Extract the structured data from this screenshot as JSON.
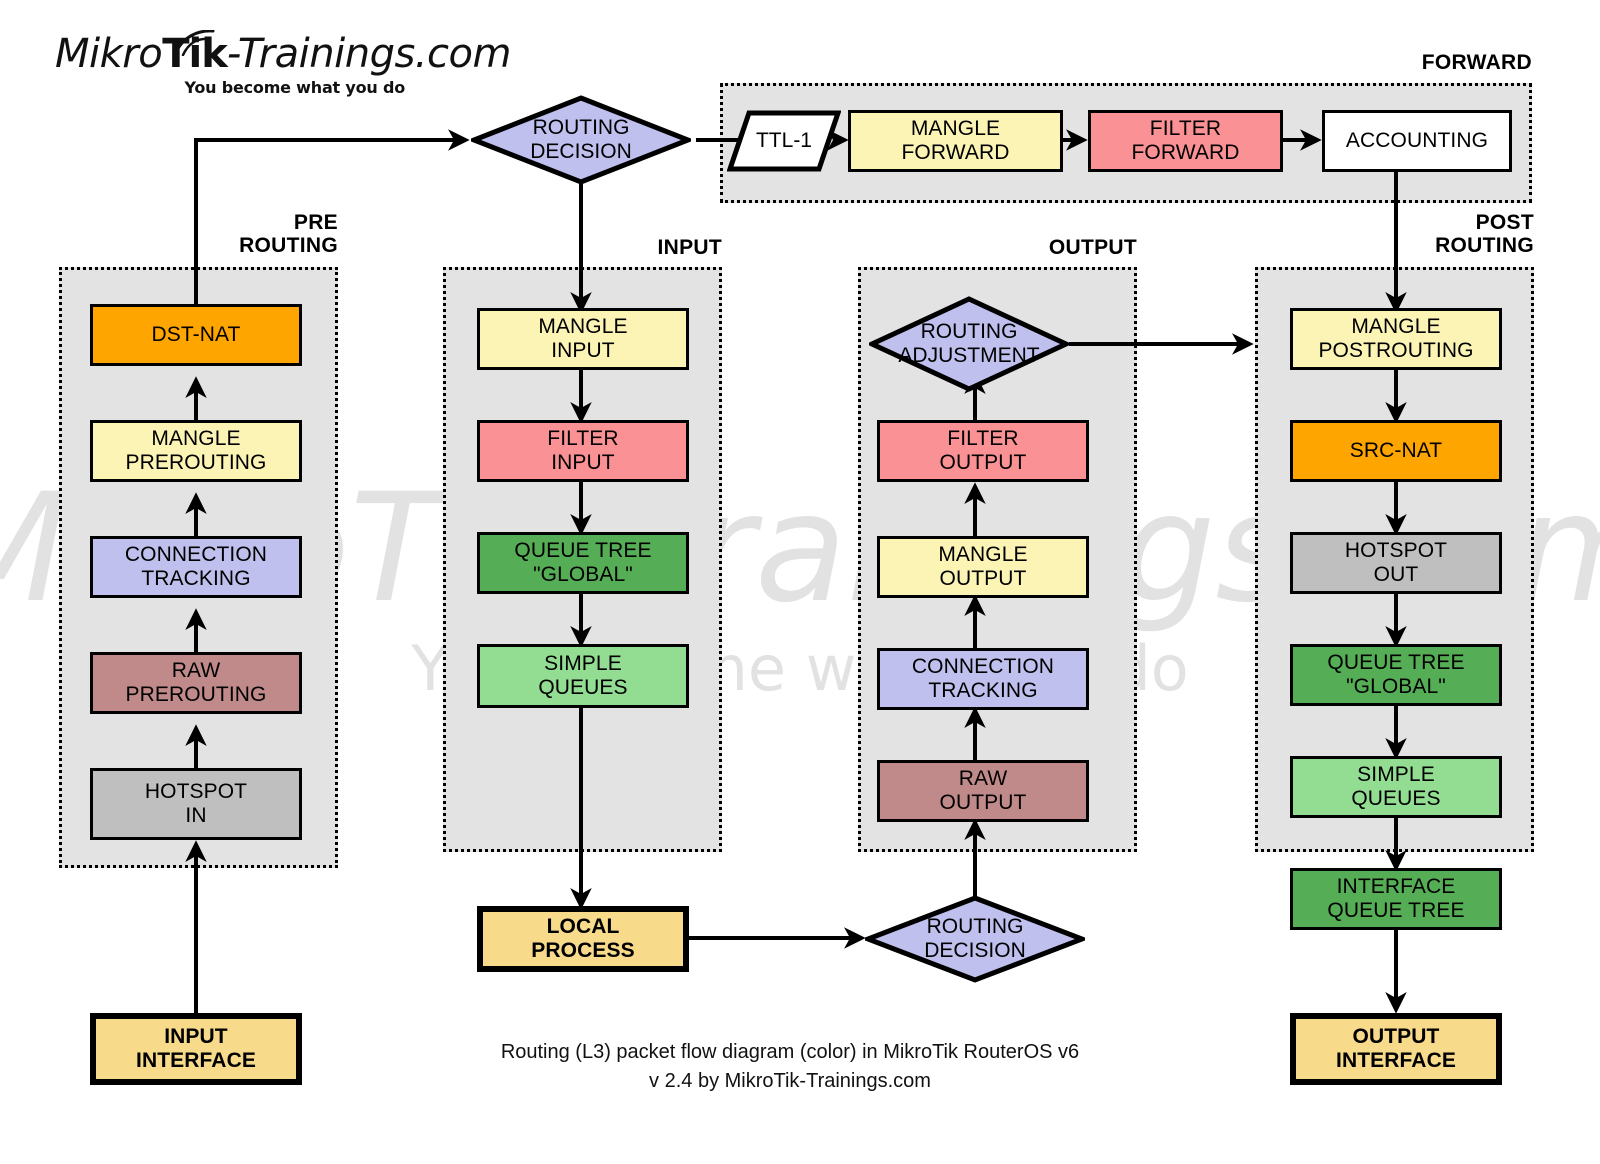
{
  "logo": {
    "part1": "Mikro",
    "part2": "Tik",
    "part3": "-Trainings.com",
    "tagline": "You become what you do"
  },
  "watermark": {
    "line1": "MikroTik-Trainings.com",
    "line2": "You become what you do"
  },
  "caption": {
    "line1": "Routing (L3) packet flow diagram (color) in MikroTik RouterOS v6",
    "line2": "v 2.4 by MikroTik-Trainings.com"
  },
  "groups": {
    "forward": {
      "label": "FORWARD"
    },
    "prerouting": {
      "label_line1": "PRE",
      "label_line2": "ROUTING"
    },
    "input": {
      "label": "INPUT"
    },
    "output": {
      "label": "OUTPUT"
    },
    "postrouting": {
      "label_line1": "POST",
      "label_line2": "ROUTING"
    }
  },
  "nodes": {
    "routing_decision_top": {
      "line1": "ROUTING",
      "line2": "DECISION",
      "color": "#bfc0ee",
      "shape": "diamond"
    },
    "ttl": {
      "line1": "TTL-1",
      "color": "#ffffff",
      "shape": "parallelogram"
    },
    "mangle_forward": {
      "line1": "MANGLE",
      "line2": "FORWARD",
      "color": "#fbf4b5"
    },
    "filter_forward": {
      "line1": "FILTER",
      "line2": "FORWARD",
      "color": "#fa9195"
    },
    "accounting": {
      "line1": "ACCOUNTING",
      "color": "#ffffff"
    },
    "dst_nat": {
      "line1": "DST-NAT",
      "color": "#ffa500"
    },
    "mangle_prerouting": {
      "line1": "MANGLE",
      "line2": "PREROUTING",
      "color": "#fbf4b5"
    },
    "connection_tracking_pre": {
      "line1": "CONNECTION",
      "line2": "TRACKING",
      "color": "#bfc0ee"
    },
    "raw_prerouting": {
      "line1": "RAW",
      "line2": "PREROUTING",
      "color": "#c08a8a"
    },
    "hotspot_in": {
      "line1": "HOTSPOT",
      "line2": "IN",
      "color": "#bfbfbf"
    },
    "input_interface": {
      "line1": "INPUT",
      "line2": "INTERFACE",
      "color": "#f7da8a"
    },
    "mangle_input": {
      "line1": "MANGLE",
      "line2": "INPUT",
      "color": "#fbf4b5"
    },
    "filter_input": {
      "line1": "FILTER",
      "line2": "INPUT",
      "color": "#fa9195"
    },
    "queue_tree_global_in": {
      "line1": "QUEUE TREE",
      "line2": "\"GLOBAL\"",
      "color": "#55ad55"
    },
    "simple_queues_in": {
      "line1": "SIMPLE",
      "line2": "QUEUES",
      "color": "#92dd92"
    },
    "local_process": {
      "line1": "LOCAL",
      "line2": "PROCESS",
      "color": "#f7da8a"
    },
    "routing_adjustment": {
      "line1": "ROUTING",
      "line2": "ADJUSTMENT",
      "color": "#bfc0ee",
      "shape": "diamond"
    },
    "filter_output": {
      "line1": "FILTER",
      "line2": "OUTPUT",
      "color": "#fa9195"
    },
    "mangle_output": {
      "line1": "MANGLE",
      "line2": "OUTPUT",
      "color": "#fbf4b5"
    },
    "connection_tracking_out": {
      "line1": "CONNECTION",
      "line2": "TRACKING",
      "color": "#bfc0ee"
    },
    "raw_output": {
      "line1": "RAW",
      "line2": "OUTPUT",
      "color": "#c08a8a"
    },
    "routing_decision_bottom": {
      "line1": "ROUTING",
      "line2": "DECISION",
      "color": "#bfc0ee",
      "shape": "diamond"
    },
    "mangle_postrouting": {
      "line1": "MANGLE",
      "line2": "POSTROUTING",
      "color": "#fbf4b5"
    },
    "src_nat": {
      "line1": "SRC-NAT",
      "color": "#ffa500"
    },
    "hotspot_out": {
      "line1": "HOTSPOT",
      "line2": "OUT",
      "color": "#bfbfbf"
    },
    "queue_tree_global_out": {
      "line1": "QUEUE TREE",
      "line2": "\"GLOBAL\"",
      "color": "#55ad55"
    },
    "simple_queues_out": {
      "line1": "SIMPLE",
      "line2": "QUEUES",
      "color": "#92dd92"
    },
    "interface_queue_tree": {
      "line1": "INTERFACE",
      "line2": "QUEUE TREE",
      "color": "#55ad55"
    },
    "output_interface": {
      "line1": "OUTPUT",
      "line2": "INTERFACE",
      "color": "#f7da8a"
    }
  }
}
